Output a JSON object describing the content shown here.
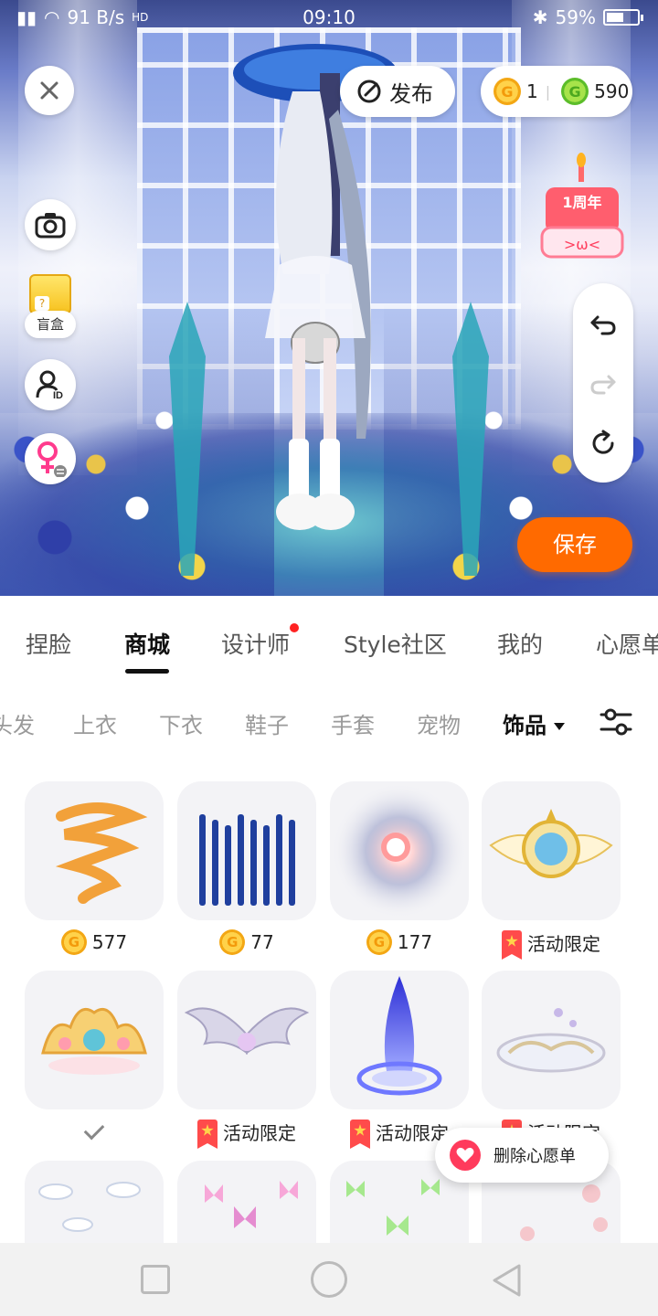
{
  "status_bar": {
    "network_speed": "91 B/s",
    "hd_badge": "HD",
    "time": "09:10",
    "battery": "59%"
  },
  "overlay": {
    "publish_label": "发布",
    "gold_coins": "1",
    "green_coins": "590",
    "blind_box_label": "盲盒",
    "save_label": "保存",
    "anniversary_badge": "1周年"
  },
  "main_tabs": [
    {
      "label": "捏脸"
    },
    {
      "label": "商城",
      "active": true
    },
    {
      "label": "设计师",
      "has_dot": true
    },
    {
      "label": "Style社区"
    },
    {
      "label": "我的"
    },
    {
      "label": "心愿单"
    }
  ],
  "sub_tabs": [
    {
      "label": "头发"
    },
    {
      "label": "上衣"
    },
    {
      "label": "下衣"
    },
    {
      "label": "鞋子"
    },
    {
      "label": "手套"
    },
    {
      "label": "宠物"
    },
    {
      "label": "饰品",
      "active": true
    }
  ],
  "items": [
    {
      "price_type": "coin",
      "price": "577",
      "art": "orange-swirl"
    },
    {
      "price_type": "coin",
      "price": "77",
      "art": "blue-bars"
    },
    {
      "price_type": "coin",
      "price": "177",
      "art": "glow-orb"
    },
    {
      "price_type": "event",
      "label": "活动限定",
      "art": "winged-crest"
    },
    {
      "price_type": "owned",
      "art": "floral-crown"
    },
    {
      "price_type": "event",
      "label": "活动限定",
      "art": "silver-wings"
    },
    {
      "price_type": "event",
      "label": "活动限定",
      "art": "blue-flame"
    },
    {
      "price_type": "event",
      "label": "活动限定",
      "art": "swirl-disc"
    },
    {
      "art": "clouds"
    },
    {
      "art": "pink-butterflies"
    },
    {
      "art": "green-butterflies"
    },
    {
      "art": "pink-petals"
    }
  ],
  "wishlist_popup": {
    "label": "删除心愿单"
  },
  "colors": {
    "accent_orange": "#ff6a00",
    "gold": "#f3a714",
    "green": "#5cbd2a",
    "event_red": "#ff4b4b",
    "tab_dot": "#ff2222"
  }
}
